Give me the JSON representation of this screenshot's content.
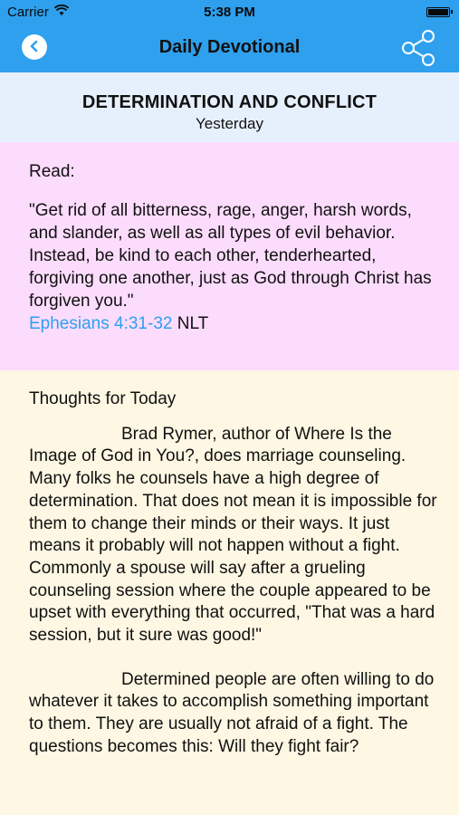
{
  "status_bar": {
    "carrier": "Carrier",
    "time": "5:38 PM"
  },
  "nav": {
    "title": "Daily Devotional",
    "back_icon": "chevron-left-icon",
    "share_icon": "share-icon"
  },
  "header": {
    "title": "DETERMINATION AND CONFLICT",
    "subtitle": "Yesterday"
  },
  "read": {
    "label": "Read:",
    "quote": "\"Get rid of all bitterness, rage, anger, harsh words, and slander, as well as all types of evil behavior. Instead, be kind to each other, tenderhearted, forgiving one another, just as God through Christ has forgiven you.\"",
    "reference": "Ephesians 4:31-32",
    "version": "NLT"
  },
  "thoughts": {
    "label": "Thoughts for Today",
    "paragraphs": [
      "Brad Rymer, author of Where Is the Image of God in You?, does marriage counseling. Many folks he counsels have a high degree of determination. That does not mean it is impossible for them to change their minds or their ways. It just means it probably will not happen without a fight. Commonly a spouse will say after a grueling counseling session where the couple appeared to be upset with everything that occurred, \"That was a hard session, but it sure was good!\"",
      "Determined people are often willing to do whatever it takes to accomplish something important to them. They are usually not afraid of a fight. The questions becomes this: Will they fight fair?"
    ]
  },
  "colors": {
    "nav_bar": "#2ea0ee",
    "header_bg": "#e6f0fc",
    "read_bg": "#fcdcfc",
    "thoughts_bg": "#fdf7e3",
    "link": "#2ea0ee"
  }
}
